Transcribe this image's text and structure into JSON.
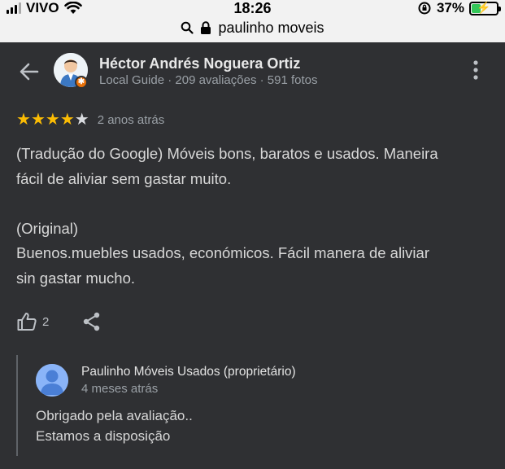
{
  "status": {
    "carrier": "VIVO",
    "time": "18:26",
    "battery": "37%",
    "battery_level": 0.37
  },
  "url_bar": {
    "text": "paulinho moveis"
  },
  "reviewer": {
    "name": "Héctor Andrés Noguera Ortiz",
    "meta": "Local Guide · 209 avaliações · 591 fotos"
  },
  "review": {
    "rating": 4,
    "max_rating": 5,
    "date": "2 anos atrás",
    "translated_line1": "(Tradução do Google) Móveis bons, baratos e usados. Maneira",
    "translated_line2": "fácil de aliviar sem gastar muito.",
    "original_label": "(Original)",
    "original_line1": "Buenos.muebles usados, económicos. Fácil manera de aliviar",
    "original_line2": "sin gastar mucho.",
    "likes": "2"
  },
  "reply": {
    "owner_name": "Paulinho Móveis Usados (proprietário)",
    "date": "4 meses atrás",
    "line1": "Obrigado pela avaliação..",
    "line2": "Estamos a disposição"
  },
  "colors": {
    "background": "#2f3033",
    "star": "#fbbc04",
    "status_bar": "#f2f2f2",
    "battery_charging": "#34c759"
  }
}
